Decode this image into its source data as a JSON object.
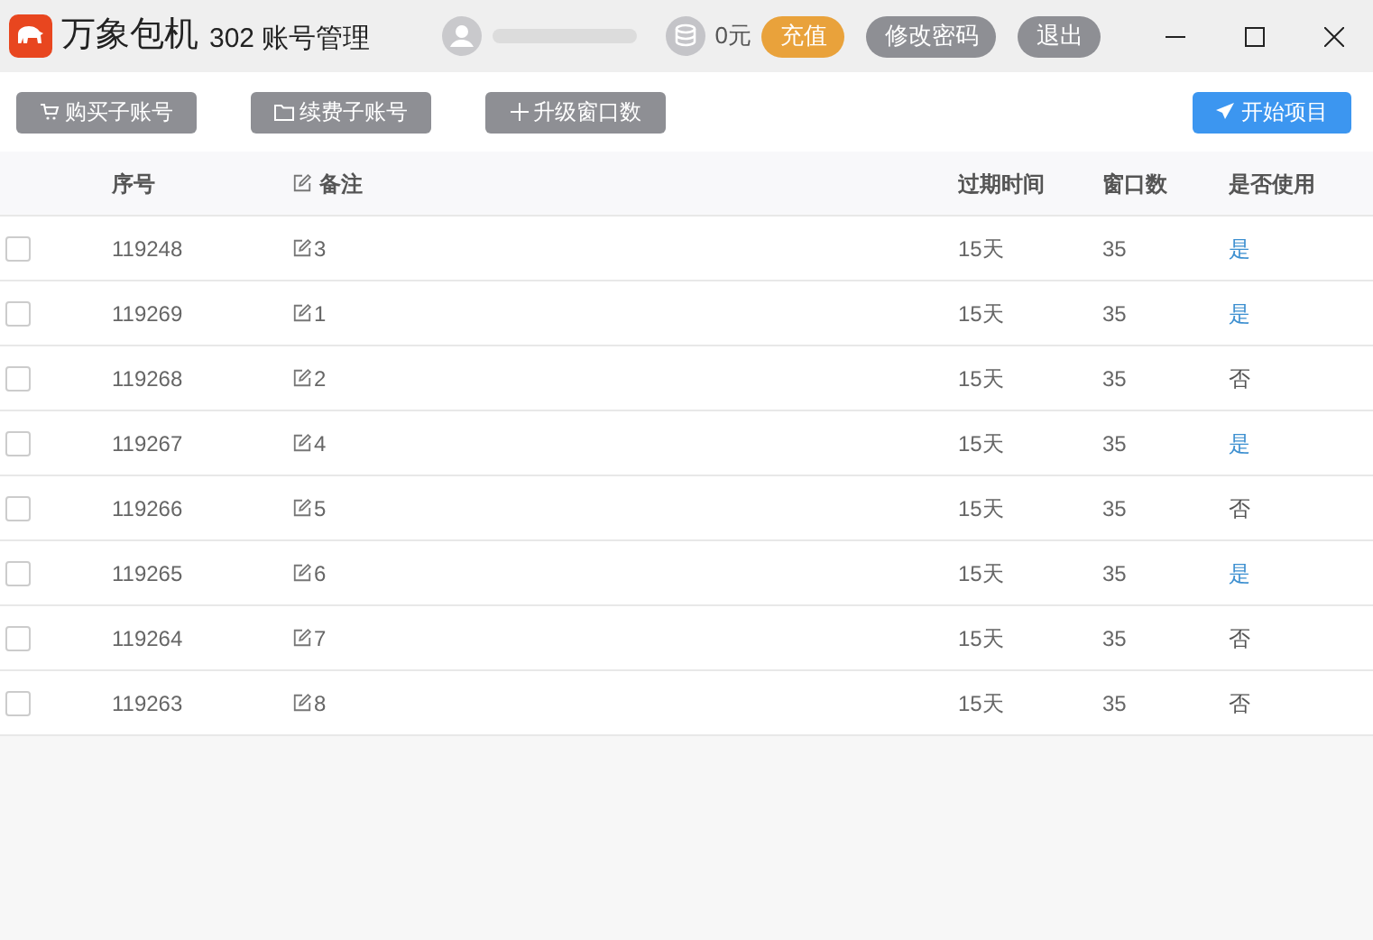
{
  "window": {
    "app_name": "万象包机",
    "subtitle": "302 账号管理",
    "balance": "0元",
    "buttons": [
      {
        "label": "充值",
        "kind": "primary"
      },
      {
        "label": "修改密码",
        "kind": "secondary"
      },
      {
        "label": "退出",
        "kind": "secondary"
      }
    ]
  },
  "toolbar": {
    "left_buttons": [
      {
        "label": "购买子账号"
      },
      {
        "label": "续费子账号"
      },
      {
        "label": "升级窗口数"
      }
    ],
    "start_button": "开始项目"
  },
  "table": {
    "columns": [
      "序号",
      "备注",
      "过期时间",
      "窗口数",
      "是否使用"
    ],
    "rows": [
      {
        "checked": false,
        "id": "119248",
        "note": "3",
        "expiry": "15天",
        "windows": "35",
        "used": true,
        "used_text": "是"
      },
      {
        "checked": false,
        "id": "119269",
        "note": "1",
        "expiry": "15天",
        "windows": "35",
        "used": true,
        "used_text": "是"
      },
      {
        "checked": false,
        "id": "119268",
        "note": "2",
        "expiry": "15天",
        "windows": "35",
        "used": false,
        "used_text": "否"
      },
      {
        "checked": false,
        "id": "119267",
        "note": "4",
        "expiry": "15天",
        "windows": "35",
        "used": true,
        "used_text": "是"
      },
      {
        "checked": false,
        "id": "119266",
        "note": "5",
        "expiry": "15天",
        "windows": "35",
        "used": false,
        "used_text": "否"
      },
      {
        "checked": false,
        "id": "119265",
        "note": "6",
        "expiry": "15天",
        "windows": "35",
        "used": true,
        "used_text": "是"
      },
      {
        "checked": false,
        "id": "119264",
        "note": "7",
        "expiry": "15天",
        "windows": "35",
        "used": false,
        "used_text": "否"
      },
      {
        "checked": false,
        "id": "119263",
        "note": "8",
        "expiry": "15天",
        "windows": "35",
        "used": false,
        "used_text": "否"
      }
    ]
  }
}
